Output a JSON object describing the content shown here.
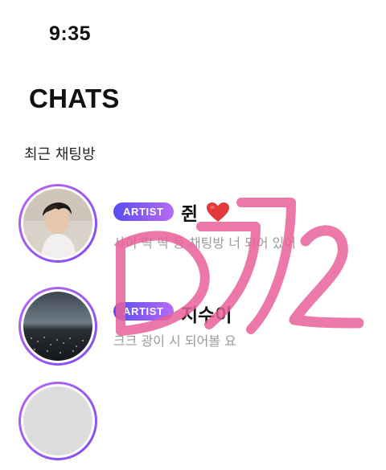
{
  "status_bar": {
    "time": "9:35"
  },
  "header": {
    "title": "CHATS"
  },
  "section": {
    "title": "최근 채팅방"
  },
  "chats": [
    {
      "badge": "ARTIST",
      "name": "쥔",
      "name_icon": "red-heart-icon",
      "preview": "사이 딱 딱 동 채팅방 너 되어 있어"
    },
    {
      "badge": "ARTIST",
      "name": "지수이",
      "preview": "크크 광이 시 되어볼 요"
    }
  ],
  "colors": {
    "accent_gradient_start": "#5a4cf2",
    "accent_gradient_end": "#b66bf2",
    "scribble": "#e8619a"
  }
}
